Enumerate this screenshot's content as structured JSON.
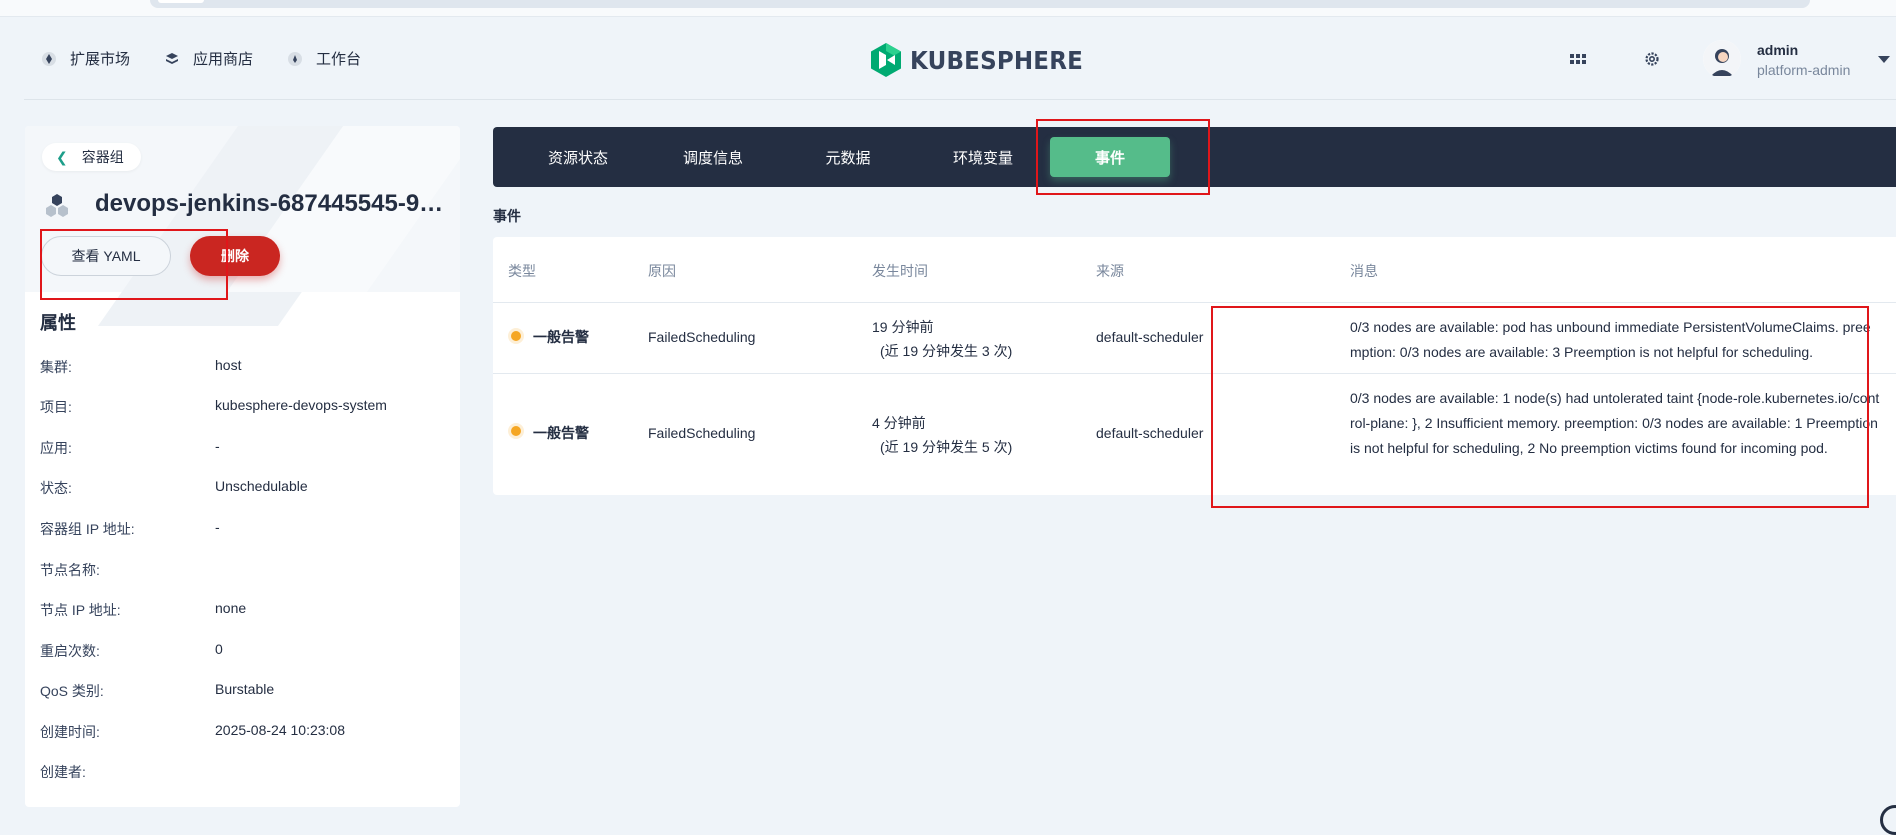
{
  "header": {
    "nav": [
      {
        "label": "扩展市场",
        "icon": "extension-icon"
      },
      {
        "label": "应用商店",
        "icon": "app-store-icon"
      },
      {
        "label": "工作台",
        "icon": "workbench-icon"
      }
    ],
    "logo_text": "KUBESPHERE",
    "user": {
      "name": "admin",
      "role": "platform-admin"
    }
  },
  "left": {
    "back_label": "容器组",
    "pod_name": "devops-jenkins-687445545-9…",
    "view_yaml_label": "查看 YAML",
    "delete_label": "删除",
    "attributes_title": "属性",
    "attributes": [
      {
        "key": "集群:",
        "value": "host"
      },
      {
        "key": "项目:",
        "value": "kubesphere-devops-system"
      },
      {
        "key": "应用:",
        "value": "-"
      },
      {
        "key": "状态:",
        "value": "Unschedulable"
      },
      {
        "key": "容器组 IP 地址:",
        "value": "-"
      },
      {
        "key": "节点名称:",
        "value": ""
      },
      {
        "key": "节点 IP 地址:",
        "value": "none"
      },
      {
        "key": "重启次数:",
        "value": "0"
      },
      {
        "key": "QoS 类别:",
        "value": "Burstable"
      },
      {
        "key": "创建时间:",
        "value": "2025-08-24 10:23:08"
      },
      {
        "key": "创建者:",
        "value": ""
      }
    ]
  },
  "tabs": [
    "资源状态",
    "调度信息",
    "元数据",
    "环境变量",
    "事件"
  ],
  "active_tab": "事件",
  "events": {
    "section_title": "事件",
    "columns": [
      "类型",
      "原因",
      "发生时间",
      "来源",
      "消息"
    ],
    "rows": [
      {
        "type": "一般告警",
        "reason": "FailedScheduling",
        "time": "19 分钟前",
        "time_detail": "(近 19 分钟发生 3 次)",
        "source": "default-scheduler",
        "message": "0/3 nodes are available: pod has unbound immediate PersistentVolumeClaims. preemption: 0/3 nodes are available: 3 Preemption is not helpful for scheduling."
      },
      {
        "type": "一般告警",
        "reason": "FailedScheduling",
        "time": "4 分钟前",
        "time_detail": "(近 19 分钟发生 5 次)",
        "source": "default-scheduler",
        "message": "0/3 nodes are available: 1 node(s) had untolerated taint {node-role.kubernetes.io/control-plane: }, 2 Insufficient memory. preemption: 0/3 nodes are available: 1 Preemption is not helpful for scheduling, 2 No preemption victims found for incoming pod."
      }
    ]
  },
  "colors": {
    "accent_green": "#55bc8a",
    "danger_red": "#ca2621",
    "dark_nav": "#242e42",
    "warning_orange": "#f5a623",
    "highlight_red": "#e0161a"
  }
}
